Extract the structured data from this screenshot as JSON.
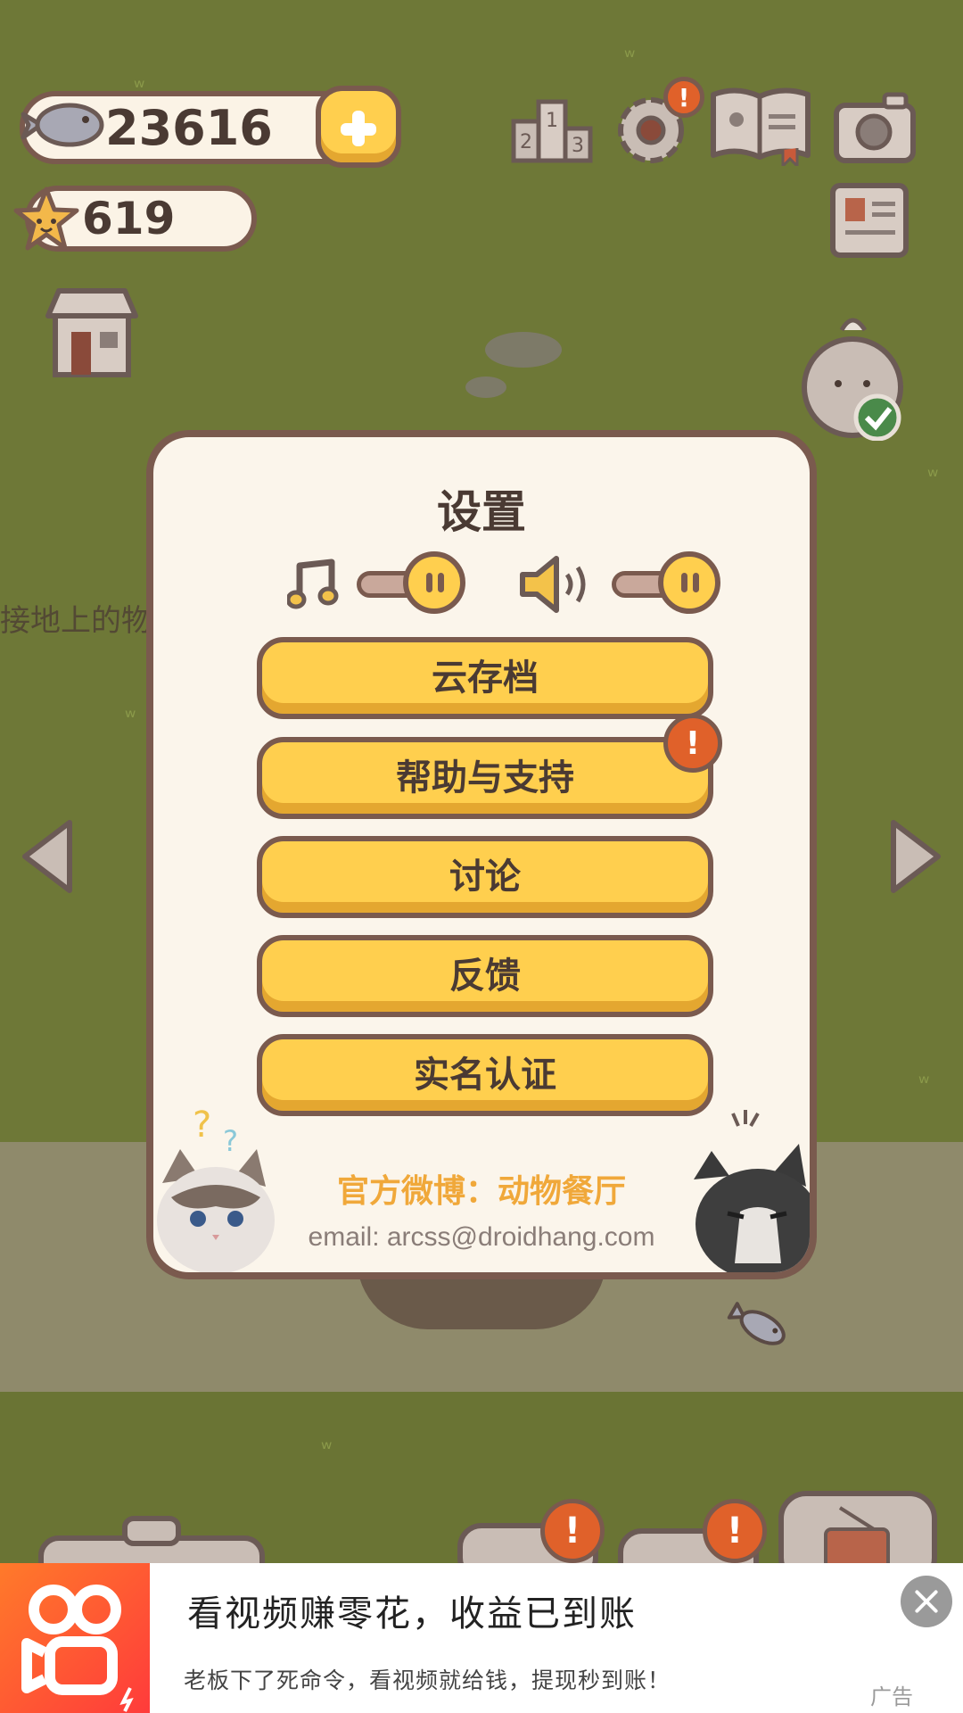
{
  "hud": {
    "fish_count": "23616",
    "star_count": "619"
  },
  "background": {
    "side_text": "接地上的物品"
  },
  "settings": {
    "title": "设置",
    "music_toggle": "on",
    "sound_toggle": "on",
    "buttons": [
      {
        "label": "云存档"
      },
      {
        "label": "帮助与支持",
        "alert": "!"
      },
      {
        "label": "讨论"
      },
      {
        "label": "反馈"
      },
      {
        "label": "实名认证"
      }
    ],
    "official_weibo": "官方微博：动物餐厅",
    "email": "email: arcss@droidhang.com"
  },
  "top_icons": {
    "settings_alert": "!",
    "bottom_alerts": [
      "!",
      "!"
    ]
  },
  "ad": {
    "title": "看视频赚零花，收益已到账",
    "subtitle": "老板下了死命令，看视频就给钱，提现秒到账！",
    "tag": "广告"
  },
  "colors": {
    "grass": "#6e7837",
    "panel": "#fbf5eb",
    "button": "#ffcf4e",
    "outline": "#7a5a4e",
    "accent_text": "#f0a83a",
    "alert": "#e0612a"
  }
}
